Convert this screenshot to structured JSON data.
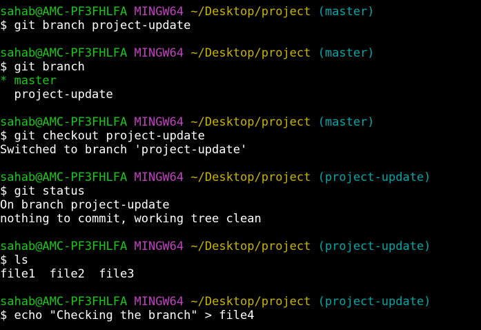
{
  "terminal": {
    "lines": [
      {
        "kind": "prompt",
        "user": "sahab@AMC-PF3FHLFA",
        "system": "MINGW64",
        "path": "~/Desktop/project",
        "branch": "(master)"
      },
      {
        "kind": "command",
        "text": "$ git branch project-update"
      },
      {
        "kind": "blank",
        "text": ""
      },
      {
        "kind": "prompt",
        "user": "sahab@AMC-PF3FHLFA",
        "system": "MINGW64",
        "path": "~/Desktop/project",
        "branch": "(master)"
      },
      {
        "kind": "command",
        "text": "$ git branch"
      },
      {
        "kind": "current",
        "text": "* master"
      },
      {
        "kind": "output",
        "text": "  project-update"
      },
      {
        "kind": "blank",
        "text": ""
      },
      {
        "kind": "prompt",
        "user": "sahab@AMC-PF3FHLFA",
        "system": "MINGW64",
        "path": "~/Desktop/project",
        "branch": "(master)"
      },
      {
        "kind": "command",
        "text": "$ git checkout project-update"
      },
      {
        "kind": "output",
        "text": "Switched to branch 'project-update'"
      },
      {
        "kind": "blank",
        "text": ""
      },
      {
        "kind": "prompt",
        "user": "sahab@AMC-PF3FHLFA",
        "system": "MINGW64",
        "path": "~/Desktop/project",
        "branch": "(project-update)"
      },
      {
        "kind": "command",
        "text": "$ git status"
      },
      {
        "kind": "output",
        "text": "On branch project-update"
      },
      {
        "kind": "output",
        "text": "nothing to commit, working tree clean"
      },
      {
        "kind": "blank",
        "text": ""
      },
      {
        "kind": "prompt",
        "user": "sahab@AMC-PF3FHLFA",
        "system": "MINGW64",
        "path": "~/Desktop/project",
        "branch": "(project-update)"
      },
      {
        "kind": "command",
        "text": "$ ls"
      },
      {
        "kind": "output",
        "text": "file1  file2  file3"
      },
      {
        "kind": "blank",
        "text": ""
      },
      {
        "kind": "prompt",
        "user": "sahab@AMC-PF3FHLFA",
        "system": "MINGW64",
        "path": "~/Desktop/project",
        "branch": "(project-update)"
      },
      {
        "kind": "command",
        "text": "$ echo \"Checking the branch\" > file4"
      }
    ]
  },
  "colors": {
    "background": "#000000",
    "user": "#19c819",
    "system": "#c040c0",
    "path": "#c8b400",
    "branch": "#00a7a7",
    "text": "#ffffff"
  }
}
